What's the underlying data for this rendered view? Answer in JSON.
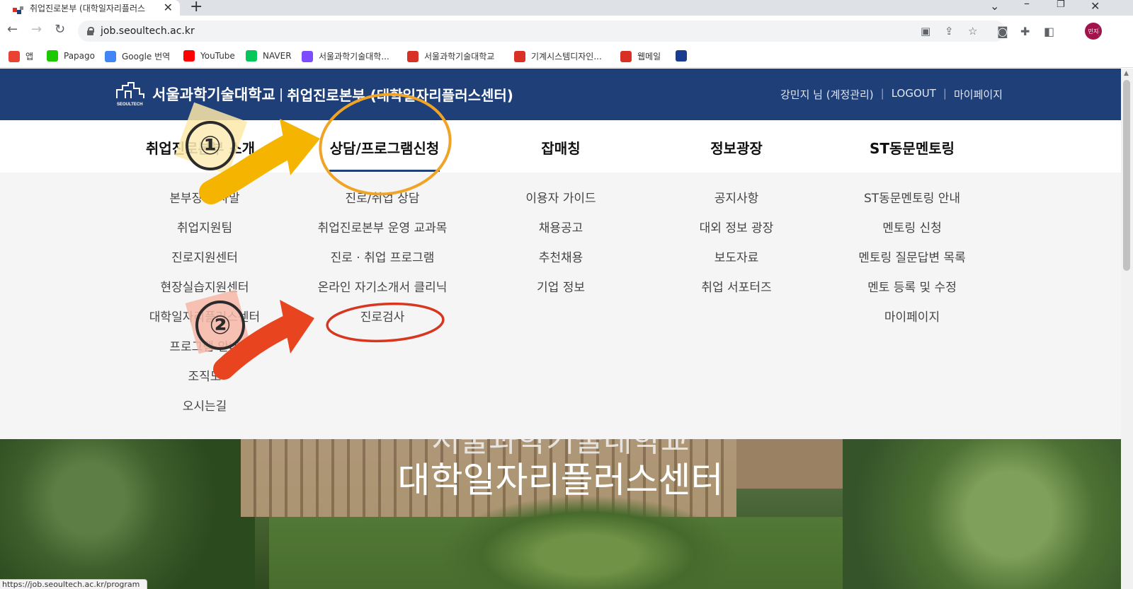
{
  "browser": {
    "tab_title": "취업진로본부 (대학일자리플러스",
    "url": "job.seoultech.ac.kr",
    "profile_label": "민지",
    "status_url": "https://job.seoultech.ac.kr/program"
  },
  "bookmarks": [
    {
      "label": "앱",
      "icon": "apps-grid-icon",
      "color": "#e94235"
    },
    {
      "label": "Papago",
      "icon": "papago-icon",
      "color": "#1ec800"
    },
    {
      "label": "Google 번역",
      "icon": "google-translate-icon",
      "color": "#4285f4"
    },
    {
      "label": "YouTube",
      "icon": "youtube-icon",
      "color": "#ff0000"
    },
    {
      "label": "NAVER",
      "icon": "naver-icon",
      "color": "#03c75a"
    },
    {
      "label": "서울과학기술대학...",
      "icon": "seoultech-icon",
      "color": "#7c4dff"
    },
    {
      "label": "서울과학기술대학교",
      "icon": "seoultech-logo-icon",
      "color": "#d93025"
    },
    {
      "label": "기계시스템디자인...",
      "icon": "seoultech-logo-icon",
      "color": "#d93025"
    },
    {
      "label": "웹메일",
      "icon": "seoultech-logo-icon",
      "color": "#d93025"
    },
    {
      "label": "",
      "icon": "h-icon",
      "color": "#1a3c8c"
    }
  ],
  "site": {
    "univ_name": "서울과학기술대학교",
    "divider": "|",
    "dept_name": "취업진로본부 (대학일자리플러스센터)",
    "logo_text": "SEOULTECH",
    "user_name": "강민지 님 (계정관리)",
    "logout": "LOGOUT",
    "mypage": "마이페이지",
    "sep": "|"
  },
  "gnb": [
    {
      "label": "취업진로본부 소개"
    },
    {
      "label": "상담/프로그램신청"
    },
    {
      "label": "잡매칭"
    },
    {
      "label": "정보광장"
    },
    {
      "label": "ST동문멘토링"
    }
  ],
  "mega_menu": {
    "col1": [
      "본부장 인사말",
      "취업지원팀",
      "진로지원센터",
      "현장실습지원센터",
      "대학일자리플러스센터",
      "프로그램 안내",
      "조직도",
      "오시는길"
    ],
    "col2": [
      "진로/취업 상담",
      "취업진로본부 운영 교과목",
      "진로 · 취업 프로그램",
      "온라인 자기소개서 클리닉",
      "진로검사"
    ],
    "col3": [
      "이용자 가이드",
      "채용공고",
      "추천채용",
      "기업 정보"
    ],
    "col4": [
      "공지사항",
      "대외 정보 광장",
      "보도자료",
      "취업 서포터즈"
    ],
    "col5": [
      "ST동문멘토링 안내",
      "멘토링 신청",
      "멘토링 질문답변 목록",
      "멘토 등록 및 수정",
      "마이페이지"
    ]
  },
  "hero": {
    "line1": "서울과학기술대학교",
    "line2": "대학일자리플러스센터"
  },
  "annotations": {
    "step1": "①",
    "step2": "②",
    "arrow1_color": "#f5b400",
    "arrow2_color": "#e8441f",
    "circle1_color": "#efa428",
    "circle2_color": "#d8361f"
  }
}
